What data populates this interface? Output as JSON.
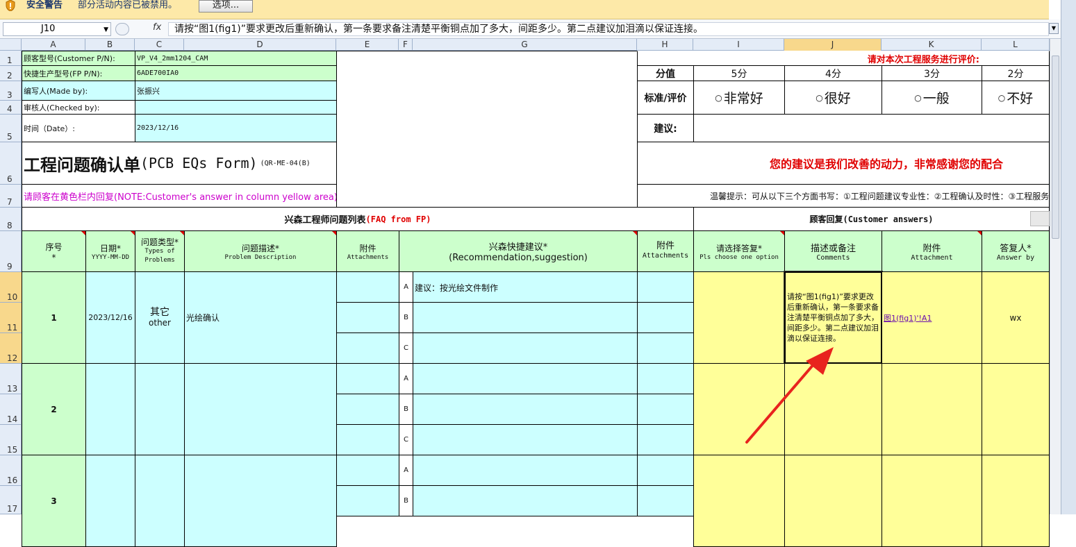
{
  "security_bar": {
    "title": "安全警告",
    "message": "部分活动内容已被禁用。",
    "options_button": "选项..."
  },
  "formula_bar": {
    "name_box": "J10",
    "fx": "fx",
    "formula": "请按“图1(fig1)”要求更改后重新确认，第一条要求备注清楚平衡铜点加了多大，间距多少。第二点建议加泪滴以保证连接。"
  },
  "columns": [
    "A",
    "B",
    "C",
    "D",
    "E",
    "F",
    "G",
    "H",
    "I",
    "J",
    "K",
    "L"
  ],
  "selected_column": "J",
  "rows": [
    "1",
    "2",
    "3",
    "4",
    "5",
    "6",
    "7",
    "8",
    "9",
    "10",
    "11",
    "12",
    "13",
    "14",
    "15",
    "16",
    "17"
  ],
  "selected_rows": [
    "10",
    "11",
    "12"
  ],
  "header_info": {
    "customer_pn_label": "顾客型号(Customer P/N):",
    "customer_pn_value": "VP_V4_2mm1204_CAM",
    "fp_pn_label": "快捷生产型号(FP P/N):",
    "fp_pn_value": "6ADE700IA0",
    "made_by_label": "编写人(Made by):",
    "made_by_value": "张振兴",
    "checked_by_label": "审核人(Checked by):",
    "checked_by_value": "",
    "date_label": "时间（Date）:",
    "date_value": "2023/12/16",
    "form_title": "工程问题确认单",
    "form_title_en": "(PCB EQs Form)",
    "form_code": "(QR-ME-04(B)",
    "note": "请顾客在黄色栏内回复(NOTE:Customer's answer in column yellow area)"
  },
  "evaluation": {
    "heading": "请对本次工程服务进行评价:",
    "score_label": "分值",
    "scores": [
      "5分",
      "4分",
      "3分",
      "2分"
    ],
    "criteria_label": "标准/评价",
    "options": [
      "非常好",
      "很好",
      "一般",
      "不好"
    ],
    "suggestion_label": "建议:",
    "slogan": "您的建议是我们改善的动力，非常感谢您的配合",
    "tip": "温馨提示：可从以下三个方面书写：①工程问题建议专业性：②工程确认及时性：③工程服务"
  },
  "table": {
    "left_title": "兴森工程师问题列表",
    "left_title_en": "(FAQ from FP)",
    "right_title": "顾客回复(Customer answers)",
    "headers": {
      "no": "序号",
      "no_star": "*",
      "date": "日期*",
      "date_fmt": "YYYY-MM-DD",
      "type": "问题类型*",
      "type_en": "Types of Problems",
      "desc": "问题描述*",
      "desc_en": "Problem Description",
      "attach": "附件",
      "attach_en": "Attachments",
      "recommend": "兴森快捷建议*",
      "recommend_en": "(Recommendation,suggestion)",
      "attach2": "附件",
      "attach2_en": "Attachments",
      "choose": "请选择答复*",
      "choose_en": "Pls choose one option",
      "comments": "描述或备注",
      "comments_en": "Comments",
      "attach3": "附件",
      "attach3_en": "Attachment",
      "answer_by": "答复人*",
      "answer_by_en": "Answer by"
    },
    "items": [
      {
        "no": "1",
        "date": "2023/12/16",
        "type": "其它",
        "type_en": "other",
        "desc": "光绘确认",
        "sub": [
          {
            "k": "A",
            "v": "建议：按光绘文件制作"
          },
          {
            "k": "B",
            "v": ""
          },
          {
            "k": "C",
            "v": ""
          }
        ],
        "comment": "请按“图1(fig1)”要求更改后重新确认，第一条要求备注清楚平衡铜点加了多大，间距多少。第二点建议加泪滴以保证连接。",
        "attachment": "图1(fig1)'!A1",
        "answer_by": "wx"
      },
      {
        "no": "2",
        "sub": [
          {
            "k": "A",
            "v": ""
          },
          {
            "k": "B",
            "v": ""
          },
          {
            "k": "C",
            "v": ""
          }
        ]
      },
      {
        "no": "3",
        "sub": [
          {
            "k": "A",
            "v": ""
          },
          {
            "k": "B",
            "v": ""
          }
        ]
      }
    ]
  },
  "colors": {
    "green": "#ccffcc",
    "cyan": "#ccffff",
    "yellow": "#ffff99",
    "accent_red": "#e00000",
    "arrow": "#e8231e"
  }
}
